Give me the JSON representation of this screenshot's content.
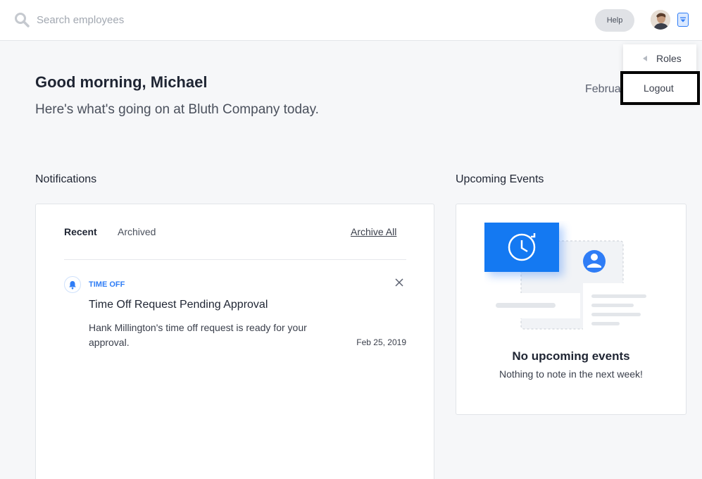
{
  "header": {
    "search_placeholder": "Search employees",
    "help_label": "Help"
  },
  "user_menu": {
    "items": [
      {
        "label": "Roles"
      },
      {
        "label": "Logout"
      }
    ]
  },
  "greeting": {
    "title": "Good morning, Michael",
    "subtitle": "Here's what's going on at Bluth Company today.",
    "date": "Februa"
  },
  "notifications": {
    "title": "Notifications",
    "tabs": [
      {
        "label": "Recent",
        "active": true
      },
      {
        "label": "Archived",
        "active": false
      }
    ],
    "archive_all_label": "Archive All",
    "items": [
      {
        "category": "TIME OFF",
        "title": "Time Off Request Pending Approval",
        "body": "Hank Millington's time off request is ready for your approval.",
        "date": "Feb 25, 2019"
      }
    ]
  },
  "events": {
    "title": "Upcoming Events",
    "empty_title": "No upcoming events",
    "empty_subtitle": "Nothing to note in the next week!"
  },
  "colors": {
    "accent": "#2f7df6",
    "background": "#f6f7f9",
    "card": "#ffffff"
  }
}
